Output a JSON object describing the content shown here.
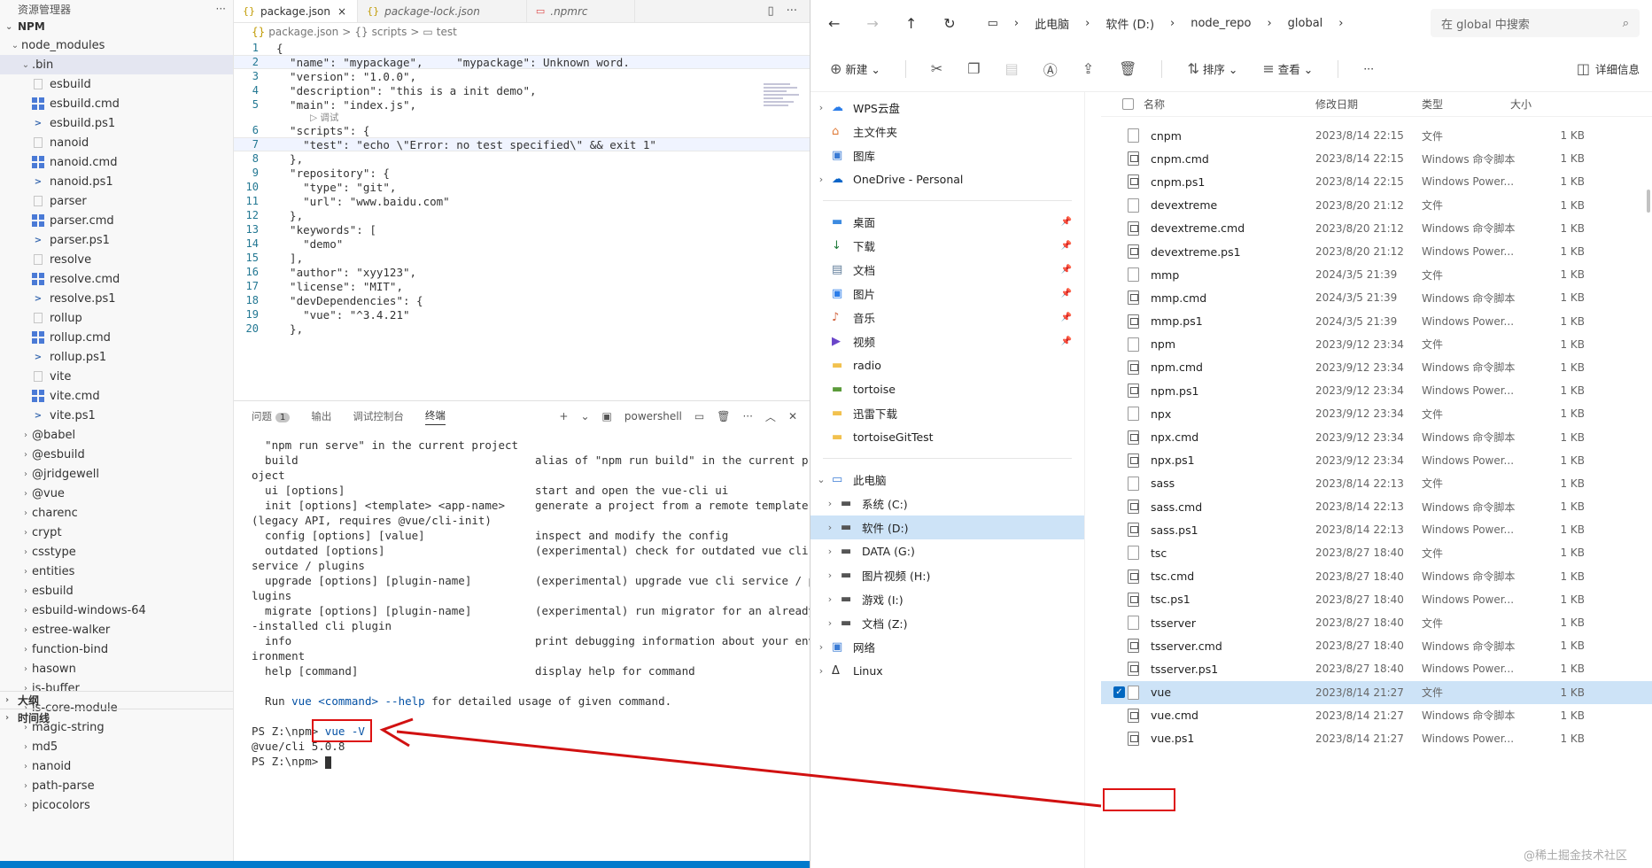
{
  "explorer": {
    "title": "资源管理器",
    "more": "···",
    "section": "NPM",
    "root_folder": "node_modules",
    "bin_folder": ".bin",
    "bin_files": [
      {
        "name": "esbuild",
        "kind": "plain"
      },
      {
        "name": "esbuild.cmd",
        "kind": "win"
      },
      {
        "name": "esbuild.ps1",
        "kind": "ps"
      },
      {
        "name": "nanoid",
        "kind": "plain"
      },
      {
        "name": "nanoid.cmd",
        "kind": "win"
      },
      {
        "name": "nanoid.ps1",
        "kind": "ps"
      },
      {
        "name": "parser",
        "kind": "plain"
      },
      {
        "name": "parser.cmd",
        "kind": "win"
      },
      {
        "name": "parser.ps1",
        "kind": "ps"
      },
      {
        "name": "resolve",
        "kind": "plain"
      },
      {
        "name": "resolve.cmd",
        "kind": "win"
      },
      {
        "name": "resolve.ps1",
        "kind": "ps"
      },
      {
        "name": "rollup",
        "kind": "plain"
      },
      {
        "name": "rollup.cmd",
        "kind": "win"
      },
      {
        "name": "rollup.ps1",
        "kind": "ps"
      },
      {
        "name": "vite",
        "kind": "plain"
      },
      {
        "name": "vite.cmd",
        "kind": "win"
      },
      {
        "name": "vite.ps1",
        "kind": "ps"
      }
    ],
    "folders": [
      "@babel",
      "@esbuild",
      "@jridgewell",
      "@vue",
      "charenc",
      "crypt",
      "csstype",
      "entities",
      "esbuild",
      "esbuild-windows-64",
      "estree-walker",
      "function-bind",
      "hasown",
      "is-buffer",
      "is-core-module",
      "magic-string",
      "md5",
      "nanoid",
      "path-parse",
      "picocolors"
    ],
    "outline": "大纲",
    "timeline": "时间线"
  },
  "editor": {
    "tabs": [
      {
        "icon": "{}",
        "label": "package.json",
        "close": "×",
        "active": true
      },
      {
        "icon": "{}",
        "label": "package-lock.json",
        "close": "",
        "active": false
      },
      {
        "icon": "▭",
        "label": ".npmrc",
        "close": "",
        "active": false
      }
    ],
    "breadcrumb": [
      "package.json",
      "scripts",
      "test"
    ],
    "breadcrumb_sep": ">",
    "code_lens": "▷ 调试",
    "lines": [
      {
        "n": "1",
        "t": "{"
      },
      {
        "n": "2",
        "t": "  \"name\": \"mypackage\",     \"mypackage\": Unknown word."
      },
      {
        "n": "3",
        "t": "  \"version\": \"1.0.0\","
      },
      {
        "n": "4",
        "t": "  \"description\": \"this is a init demo\","
      },
      {
        "n": "5",
        "t": "  \"main\": \"index.js\","
      },
      {
        "n": "6",
        "t": "  \"scripts\": {"
      },
      {
        "n": "7",
        "t": "    \"test\": \"echo \\\"Error: no test specified\\\" && exit 1\""
      },
      {
        "n": "8",
        "t": "  },"
      },
      {
        "n": "9",
        "t": "  \"repository\": {"
      },
      {
        "n": "10",
        "t": "    \"type\": \"git\","
      },
      {
        "n": "11",
        "t": "    \"url\": \"www.baidu.com\""
      },
      {
        "n": "12",
        "t": "  },"
      },
      {
        "n": "13",
        "t": "  \"keywords\": ["
      },
      {
        "n": "14",
        "t": "    \"demo\""
      },
      {
        "n": "15",
        "t": "  ],"
      },
      {
        "n": "16",
        "t": "  \"author\": \"xyy123\","
      },
      {
        "n": "17",
        "t": "  \"license\": \"MIT\","
      },
      {
        "n": "18",
        "t": "  \"devDependencies\": {"
      },
      {
        "n": "19",
        "t": "    \"vue\": \"^3.4.21\""
      },
      {
        "n": "20",
        "t": "  },"
      }
    ]
  },
  "panel": {
    "tabs": [
      "问题",
      "输出",
      "调试控制台",
      "终端"
    ],
    "problems_count": "1",
    "shell": "powershell",
    "plus": "+",
    "actions": [
      "▭",
      "🗑",
      "···",
      "︿",
      "✕"
    ]
  },
  "terminal": {
    "rows": [
      {
        "a": "  \"npm run serve\" in the current project",
        "b": ""
      },
      {
        "a": "  build",
        "b": "alias of \"npm run build\" in the current pr"
      },
      {
        "a": "oject",
        "b": ""
      },
      {
        "a": "  ui [options]",
        "b": "start and open the vue-cli ui"
      },
      {
        "a": "  init [options] <template> <app-name>",
        "b": "generate a project from a remote template"
      },
      {
        "a": "(legacy API, requires @vue/cli-init)",
        "b": ""
      },
      {
        "a": "  config [options] [value]",
        "b": "inspect and modify the config"
      },
      {
        "a": "  outdated [options]",
        "b": "(experimental) check for outdated vue cli"
      },
      {
        "a": "service / plugins",
        "b": ""
      },
      {
        "a": "  upgrade [options] [plugin-name]",
        "b": "(experimental) upgrade vue cli service / p"
      },
      {
        "a": "lugins",
        "b": ""
      },
      {
        "a": "  migrate [options] [plugin-name]",
        "b": "(experimental) run migrator for an already"
      },
      {
        "a": "-installed cli plugin",
        "b": ""
      },
      {
        "a": "  info",
        "b": "print debugging information about your env"
      },
      {
        "a": "ironment",
        "b": ""
      },
      {
        "a": "  help [command]",
        "b": "display help for command"
      },
      {
        "a": "",
        "b": ""
      }
    ],
    "usage_pre": "  Run ",
    "usage_vue": "vue",
    "usage_cmd": "<command>",
    "usage_help": "--help",
    "usage_post": " for detailed usage of given command.",
    "prompt1": "PS Z:\\npm> ",
    "command": "vue -V",
    "output": "@vue/cli 5.0.8",
    "prompt2": "PS Z:\\npm> "
  },
  "file_explorer": {
    "address": [
      "此电脑",
      "软件 (D:)",
      "node_repo",
      "global"
    ],
    "search_placeholder": "在 global 中搜索",
    "toolbar": {
      "new": "新建",
      "sort": "排序",
      "view": "查看",
      "more": "···",
      "details": "详细信息"
    },
    "nav_groups": [
      [
        {
          "label": "WPS云盘",
          "icon": "cloud",
          "chev": "›",
          "color": "#2b7de9"
        },
        {
          "label": "主文件夹",
          "icon": "home",
          "chev": "",
          "color": "#e07b39"
        },
        {
          "label": "图库",
          "icon": "gallery",
          "chev": "",
          "color": "#3a7bd5"
        },
        {
          "label": "OneDrive - Personal",
          "icon": "cloud",
          "chev": "›",
          "color": "#0a64c8"
        }
      ],
      [
        {
          "label": "桌面",
          "icon": "desktop",
          "chev": "",
          "color": "#3d8be0",
          "pin": true
        },
        {
          "label": "下载",
          "icon": "download",
          "chev": "",
          "color": "#1f7a3a",
          "pin": true
        },
        {
          "label": "文档",
          "icon": "doc",
          "chev": "",
          "color": "#607d9a",
          "pin": true
        },
        {
          "label": "图片",
          "icon": "pic",
          "chev": "",
          "color": "#2b7de9",
          "pin": true
        },
        {
          "label": "音乐",
          "icon": "music",
          "chev": "",
          "color": "#d0603a",
          "pin": true
        },
        {
          "label": "视频",
          "icon": "video",
          "chev": "",
          "color": "#6a45c9",
          "pin": true
        },
        {
          "label": "radio",
          "icon": "folder",
          "chev": "",
          "color": "#f2c14e"
        },
        {
          "label": "tortoise",
          "icon": "folder",
          "chev": "",
          "color": "#5b9b3a"
        },
        {
          "label": "迅雷下载",
          "icon": "folder",
          "chev": "",
          "color": "#f2c14e"
        },
        {
          "label": "tortoiseGitTest",
          "icon": "folder",
          "chev": "",
          "color": "#f2c14e"
        }
      ],
      [
        {
          "label": "此电脑",
          "icon": "pc",
          "chev": "⌄",
          "color": "#3a7bd5"
        },
        {
          "label": "系统 (C:)",
          "icon": "drive",
          "chev": "›",
          "color": "#555",
          "indent": true
        },
        {
          "label": "软件 (D:)",
          "icon": "drive",
          "chev": "›",
          "color": "#555",
          "indent": true,
          "selected": true
        },
        {
          "label": "DATA (G:)",
          "icon": "drive",
          "chev": "›",
          "color": "#555",
          "indent": true
        },
        {
          "label": "图片视频 (H:)",
          "icon": "drive",
          "chev": "›",
          "color": "#555",
          "indent": true
        },
        {
          "label": "游戏 (I:)",
          "icon": "drive",
          "chev": "›",
          "color": "#555",
          "indent": true
        },
        {
          "label": "文档 (Z:)",
          "icon": "drive",
          "chev": "›",
          "color": "#555",
          "indent": true
        },
        {
          "label": "网络",
          "icon": "net",
          "chev": "›",
          "color": "#3a7bd5"
        },
        {
          "label": "Linux",
          "icon": "linux",
          "chev": "›",
          "color": "#333"
        }
      ]
    ],
    "columns": {
      "name": "名称",
      "date": "修改日期",
      "type": "类型",
      "size": "大小"
    },
    "files": [
      {
        "name": "cnpm",
        "date": "2023/8/14 22:15",
        "type": "文件",
        "size": "1 KB",
        "kind": "plain"
      },
      {
        "name": "cnpm.cmd",
        "date": "2023/8/14 22:15",
        "type": "Windows 命令脚本",
        "size": "1 KB",
        "kind": "cmd"
      },
      {
        "name": "cnpm.ps1",
        "date": "2023/8/14 22:15",
        "type": "Windows Power...",
        "size": "1 KB",
        "kind": "ps"
      },
      {
        "name": "devextreme",
        "date": "2023/8/20 21:12",
        "type": "文件",
        "size": "1 KB",
        "kind": "plain"
      },
      {
        "name": "devextreme.cmd",
        "date": "2023/8/20 21:12",
        "type": "Windows 命令脚本",
        "size": "1 KB",
        "kind": "cmd"
      },
      {
        "name": "devextreme.ps1",
        "date": "2023/8/20 21:12",
        "type": "Windows Power...",
        "size": "1 KB",
        "kind": "ps"
      },
      {
        "name": "mmp",
        "date": "2024/3/5 21:39",
        "type": "文件",
        "size": "1 KB",
        "kind": "plain"
      },
      {
        "name": "mmp.cmd",
        "date": "2024/3/5 21:39",
        "type": "Windows 命令脚本",
        "size": "1 KB",
        "kind": "cmd"
      },
      {
        "name": "mmp.ps1",
        "date": "2024/3/5 21:39",
        "type": "Windows Power...",
        "size": "1 KB",
        "kind": "ps"
      },
      {
        "name": "npm",
        "date": "2023/9/12 23:34",
        "type": "文件",
        "size": "1 KB",
        "kind": "plain"
      },
      {
        "name": "npm.cmd",
        "date": "2023/9/12 23:34",
        "type": "Windows 命令脚本",
        "size": "1 KB",
        "kind": "cmd"
      },
      {
        "name": "npm.ps1",
        "date": "2023/9/12 23:34",
        "type": "Windows Power...",
        "size": "1 KB",
        "kind": "ps"
      },
      {
        "name": "npx",
        "date": "2023/9/12 23:34",
        "type": "文件",
        "size": "1 KB",
        "kind": "plain"
      },
      {
        "name": "npx.cmd",
        "date": "2023/9/12 23:34",
        "type": "Windows 命令脚本",
        "size": "1 KB",
        "kind": "cmd"
      },
      {
        "name": "npx.ps1",
        "date": "2023/9/12 23:34",
        "type": "Windows Power...",
        "size": "1 KB",
        "kind": "ps"
      },
      {
        "name": "sass",
        "date": "2023/8/14 22:13",
        "type": "文件",
        "size": "1 KB",
        "kind": "plain"
      },
      {
        "name": "sass.cmd",
        "date": "2023/8/14 22:13",
        "type": "Windows 命令脚本",
        "size": "1 KB",
        "kind": "cmd"
      },
      {
        "name": "sass.ps1",
        "date": "2023/8/14 22:13",
        "type": "Windows Power...",
        "size": "1 KB",
        "kind": "ps"
      },
      {
        "name": "tsc",
        "date": "2023/8/27 18:40",
        "type": "文件",
        "size": "1 KB",
        "kind": "plain"
      },
      {
        "name": "tsc.cmd",
        "date": "2023/8/27 18:40",
        "type": "Windows 命令脚本",
        "size": "1 KB",
        "kind": "cmd"
      },
      {
        "name": "tsc.ps1",
        "date": "2023/8/27 18:40",
        "type": "Windows Power...",
        "size": "1 KB",
        "kind": "ps"
      },
      {
        "name": "tsserver",
        "date": "2023/8/27 18:40",
        "type": "文件",
        "size": "1 KB",
        "kind": "plain"
      },
      {
        "name": "tsserver.cmd",
        "date": "2023/8/27 18:40",
        "type": "Windows 命令脚本",
        "size": "1 KB",
        "kind": "cmd"
      },
      {
        "name": "tsserver.ps1",
        "date": "2023/8/27 18:40",
        "type": "Windows Power...",
        "size": "1 KB",
        "kind": "ps"
      },
      {
        "name": "vue",
        "date": "2023/8/14 21:27",
        "type": "文件",
        "size": "1 KB",
        "kind": "plain",
        "selected": true
      },
      {
        "name": "vue.cmd",
        "date": "2023/8/14 21:27",
        "type": "Windows 命令脚本",
        "size": "1 KB",
        "kind": "cmd"
      },
      {
        "name": "vue.ps1",
        "date": "2023/8/14 21:27",
        "type": "Windows Power...",
        "size": "1 KB",
        "kind": "ps"
      }
    ],
    "watermark": "@稀土掘金技术社区"
  },
  "colors": {
    "annotation": "#d11111",
    "status_blue": "#007acc",
    "selection": "#cde3f7"
  }
}
